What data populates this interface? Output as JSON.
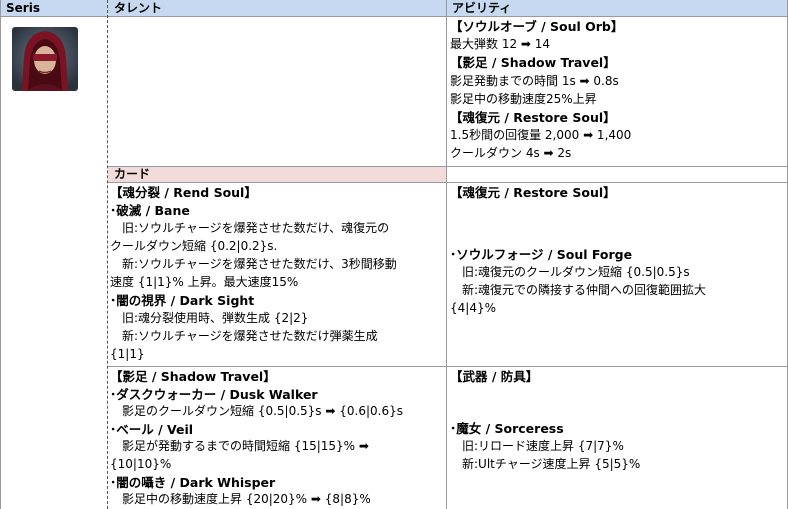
{
  "header": {
    "character": "Seris",
    "talent": "タレント",
    "ability": "アビリティ",
    "card": "カード"
  },
  "colors": {
    "header_blue": "#c6d9f1",
    "card_pink": "#f2dcdb",
    "grid": "#9a9a9a"
  },
  "ability_block": [
    {
      "text": "【ソウルオーブ / Soul Orb】",
      "bold": true
    },
    {
      "text": "最大弾数 12 ➡ 14",
      "bold": false
    },
    {
      "text": "【影足 / Shadow Travel】",
      "bold": true
    },
    {
      "text": "影足発動までの時間 1s ➡ 0.8s",
      "bold": false
    },
    {
      "text": "影足中の移動速度25%上昇",
      "bold": false
    },
    {
      "text": "【魂復元 / Restore Soul】",
      "bold": true
    },
    {
      "text": "1.5秒間の回復量 2,000 ➡ 1,400",
      "bold": false
    },
    {
      "text": "クールダウン 4s ➡ 2s",
      "bold": false
    }
  ],
  "cards_left_1": [
    {
      "text": "【魂分裂 / Rend Soul】",
      "bold": true
    },
    {
      "text": "･破滅 / Bane",
      "bold": true
    },
    {
      "text": "　旧:ソウルチャージを爆発させた数だけ、魂復元の",
      "bold": false
    },
    {
      "text": "クールダウン短縮 {0.2|0.2}s.",
      "bold": false
    },
    {
      "text": "　新:ソウルチャージを爆発させた数だけ、3秒間移動",
      "bold": false
    },
    {
      "text": "速度 {1|1}% 上昇。最大速度15%",
      "bold": false
    },
    {
      "text": "･闇の視界 / Dark Sight",
      "bold": true
    },
    {
      "text": "　旧:魂分裂使用時、弾数生成 {2|2}",
      "bold": false
    },
    {
      "text": "　新:ソウルチャージを爆発させた数だけ弾薬生成",
      "bold": false
    },
    {
      "text": "{1|1}",
      "bold": false
    }
  ],
  "cards_right_1_title": "【魂復元 / Restore Soul】",
  "cards_right_1": [
    {
      "text": "･ソウルフォージ / Soul Forge",
      "bold": true
    },
    {
      "text": "　旧:魂復元のクールダウン短縮 {0.5|0.5}s",
      "bold": false
    },
    {
      "text": "　新:魂復元での隣接する仲間への回復範囲拡大",
      "bold": false
    },
    {
      "text": "{4|4}%",
      "bold": false
    }
  ],
  "cards_left_2": [
    {
      "text": "【影足 / Shadow Travel】",
      "bold": true
    },
    {
      "text": "･ダスクウォーカー / Dusk Walker",
      "bold": true
    },
    {
      "text": "　影足のクールダウン短縮 {0.5|0.5}s ➡ {0.6|0.6}s",
      "bold": false
    },
    {
      "text": "･ベール / Veil",
      "bold": true
    },
    {
      "text": "　影足が発動するまでの時間短縮 {15|15}% ➡",
      "bold": false
    },
    {
      "text": "{10|10}%",
      "bold": false
    },
    {
      "text": "･闇の囁き / Dark Whisper",
      "bold": true
    },
    {
      "text": "　影足中の移動速度上昇 {20|20}% ➡ {8|8}%",
      "bold": false
    }
  ],
  "cards_right_2_title": "【武器 / 防具】",
  "cards_right_2": [
    {
      "text": "･魔女 / Sorceress",
      "bold": true
    },
    {
      "text": "　旧:リロード速度上昇 {7|7}%",
      "bold": false
    },
    {
      "text": "　新:Ultチャージ速度上昇 {5|5}%",
      "bold": false
    }
  ]
}
